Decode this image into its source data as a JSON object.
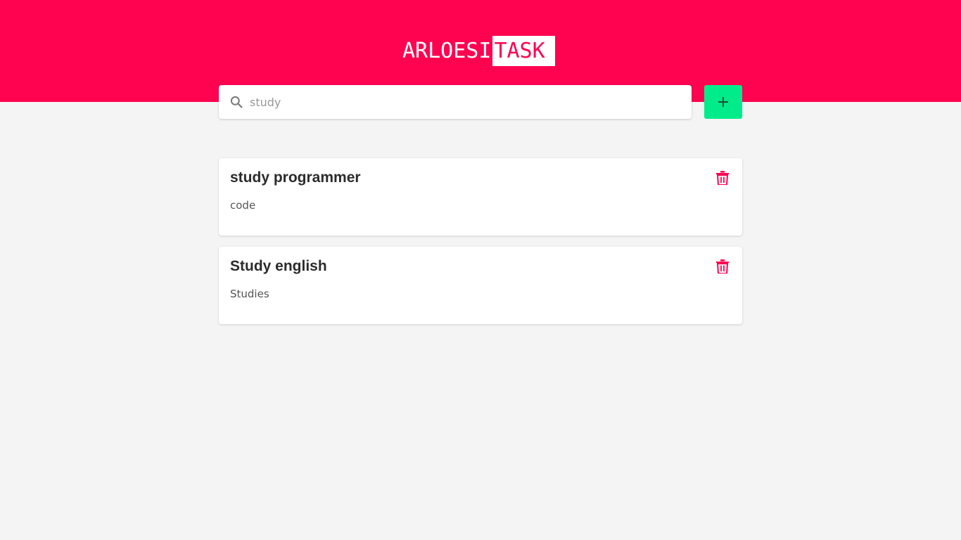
{
  "header": {
    "logo_part1": "ARLOESI",
    "logo_part2": "TASK",
    "background_color": "#ff0351"
  },
  "search": {
    "value": "study",
    "icon": "search-icon"
  },
  "add_button": {
    "icon": "plus-icon",
    "color": "#00ec8a"
  },
  "tasks": [
    {
      "title": "study programmer",
      "description": "code"
    },
    {
      "title": "Study english",
      "description": "Studies"
    }
  ],
  "delete_icon": "trash-icon",
  "accent_color": "#ff0351"
}
